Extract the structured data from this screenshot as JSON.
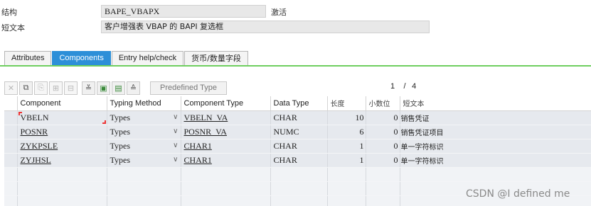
{
  "header": {
    "structure_label": "结构",
    "structure_value": "BAPE_VBAPX",
    "status": "激活",
    "short_text_label": "短文本",
    "short_text_value": "客户增强表 VBAP 的 BAPI 复选框"
  },
  "tabs": [
    {
      "label": "Attributes",
      "active": false
    },
    {
      "label": "Components",
      "active": true
    },
    {
      "label": "Entry help/check",
      "active": false
    },
    {
      "label": "货币/数量字段",
      "active": false
    }
  ],
  "toolbar": {
    "icons": [
      "cut-icon",
      "copy-icon",
      "paste-icon",
      "insert-row-icon",
      "delete-row-icon",
      "expand-all-icon",
      "append-icon",
      "insert-icon",
      "collapse-all-icon"
    ],
    "predefined_type_label": "Predefined Type"
  },
  "pager": {
    "current": "1",
    "total": "4"
  },
  "table": {
    "columns": [
      "Component",
      "Typing Method",
      "Component Type",
      "Data Type",
      "长度",
      "小数位",
      "短文本"
    ],
    "rows": [
      {
        "component": "VBELN",
        "typing_method": "Types",
        "component_type": "VBELN_VA",
        "data_type": "CHAR",
        "length": "10",
        "decimals": "0",
        "short_text": "销售凭证"
      },
      {
        "component": "POSNR",
        "typing_method": "Types",
        "component_type": "POSNR_VA",
        "data_type": "NUMC",
        "length": "6",
        "decimals": "0",
        "short_text": "销售凭证项目"
      },
      {
        "component": "ZYKPSLE",
        "typing_method": "Types",
        "component_type": "CHAR1",
        "data_type": "CHAR",
        "length": "1",
        "decimals": "0",
        "short_text": "单一字符标识"
      },
      {
        "component": "ZYJHSL",
        "typing_method": "Types",
        "component_type": "CHAR1",
        "data_type": "CHAR",
        "length": "1",
        "decimals": "0",
        "short_text": "单一字符标识"
      }
    ]
  },
  "watermark": "CSDN @I defined me"
}
